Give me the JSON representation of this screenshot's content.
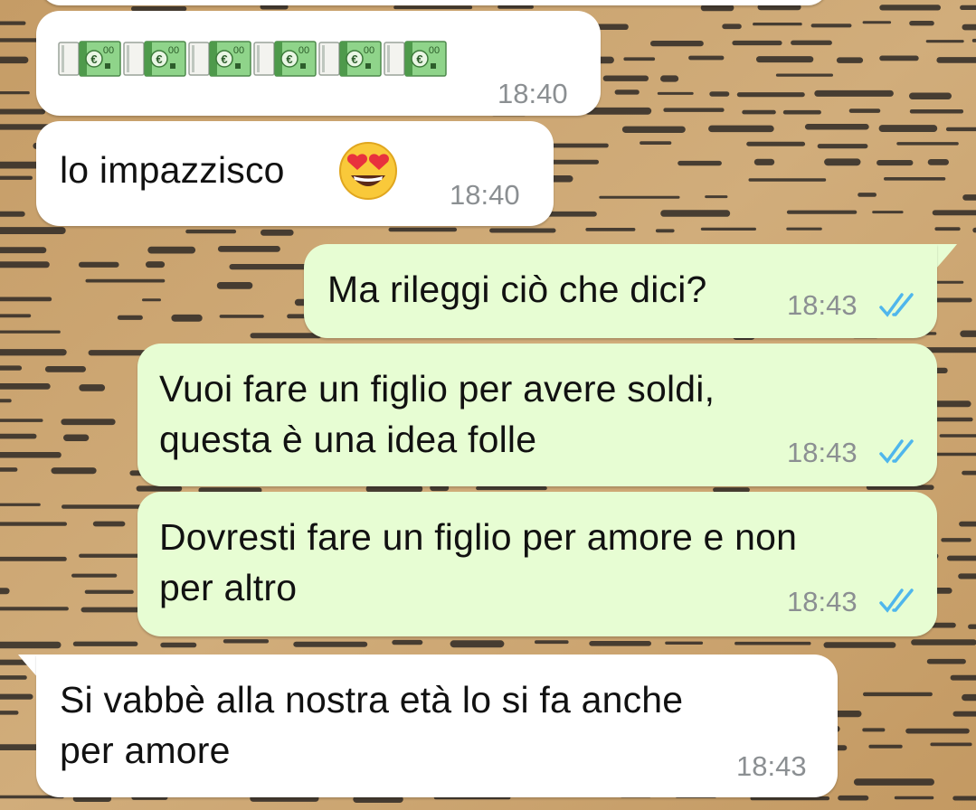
{
  "chat": {
    "messages": [
      {
        "id": "m0",
        "direction": "incoming",
        "text": "",
        "time": ""
      },
      {
        "id": "m1",
        "direction": "incoming",
        "content": "money-with-wings-euro-emoji x6",
        "time": "18:40"
      },
      {
        "id": "m2",
        "direction": "incoming",
        "text": "lo impazzisco",
        "emoji": "smiling-face-with-heart-eyes",
        "time": "18:40"
      },
      {
        "id": "m3",
        "direction": "outgoing",
        "text": "Ma rileggi ciò che dici?",
        "time": "18:43",
        "status": "read"
      },
      {
        "id": "m4",
        "direction": "outgoing",
        "lines": [
          "Vuoi fare un figlio per avere soldi,",
          "questa è una idea folle"
        ],
        "time": "18:43",
        "status": "read"
      },
      {
        "id": "m5",
        "direction": "outgoing",
        "lines": [
          "Dovresti fare un figlio per amore e non",
          "per altro"
        ],
        "time": "18:43",
        "status": "read"
      },
      {
        "id": "m6",
        "direction": "incoming",
        "lines": [
          "Si vabbè alla nostra età lo si fa anche",
          "per amore"
        ],
        "time": "18:43"
      }
    ]
  },
  "colors": {
    "incoming_bubble": "#ffffff",
    "outgoing_bubble": "#e7fdd3",
    "read_ticks": "#4fb6ec",
    "timestamp": "#8b8f92",
    "wallpaper": "#c9a370"
  }
}
